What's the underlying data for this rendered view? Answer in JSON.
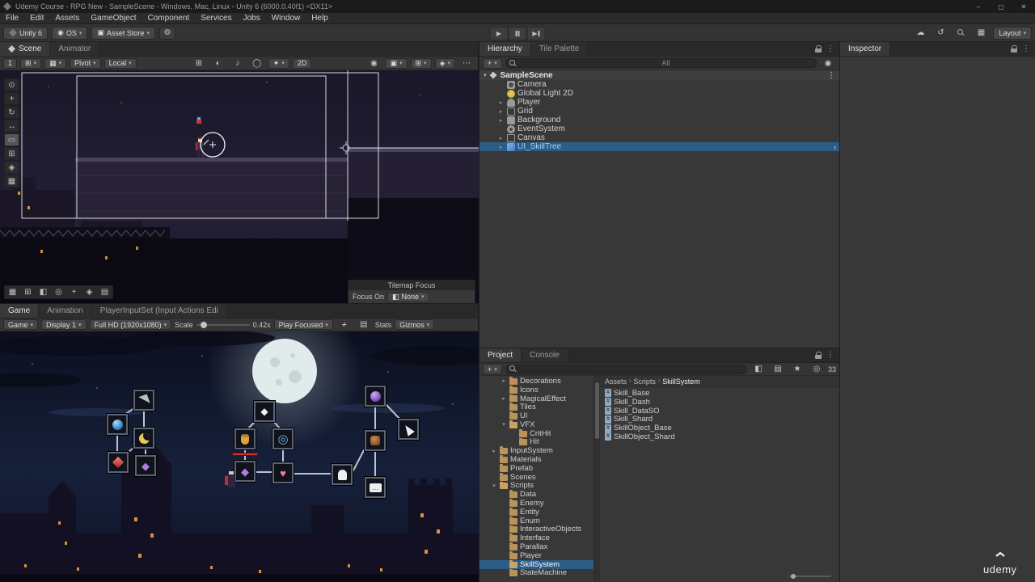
{
  "window": {
    "title": "Udemy Course - RPG New - SampleScene - Windows, Mac, Linux - Unity 6 (6000.0.40f1) <DX11>",
    "controls": {
      "minimize": "–",
      "maximize": "▢",
      "close": "✕"
    }
  },
  "menu": {
    "items": [
      "File",
      "Edit",
      "Assets",
      "GameObject",
      "Component",
      "Services",
      "Jobs",
      "Window",
      "Help"
    ]
  },
  "toolbar": {
    "unity_badge": "Unity 6",
    "os": "OS",
    "asset_store": "Asset Store",
    "layout": "Layout"
  },
  "icons": {
    "caret": "▾",
    "play": "▶",
    "bar": "▏",
    "cloud": "☁",
    "history": "↺",
    "layers": "▦",
    "more": "⋮",
    "ellipsis": "⋯",
    "plus": "+",
    "unity": "◈",
    "user": "◉",
    "bag": "▣",
    "gear": "⚙",
    "arrow_right": "▸",
    "arrow_down": "▾",
    "chevron": "›",
    "star": "★",
    "grid": "⊞",
    "grid_fill": "▦",
    "contrast": "◐",
    "note": "♪",
    "circle": "◯",
    "spark": "✦",
    "camera": "▣",
    "hash": "#",
    "dots3": "…",
    "diamond": "◆",
    "ring": "◎",
    "heart": "♥",
    "eye": "◉",
    "label_tag": "▤",
    "box_half": "◧",
    "target": "◎",
    "tool_view": "⊙",
    "tool_move": "+",
    "tool_rotate": "↻",
    "tool_scale": "↔",
    "tool_rect": "▭",
    "tool_transform": "⊞",
    "tool_custom": "◈",
    "tool_extra": "▦"
  },
  "scene": {
    "tabs": {
      "scene": "Scene",
      "animator": "Animator"
    },
    "toolbar": {
      "tool_number": "1",
      "pivot": "Pivot",
      "orientation": "Local",
      "mode2d": "2D"
    },
    "tilemap_focus": {
      "title": "Tilemap Focus",
      "label": "Focus On",
      "value": "None"
    }
  },
  "game": {
    "tabs": {
      "game": "Game",
      "animation": "Animation",
      "input": "PlayerInputSet (Input Actions Edi"
    },
    "toolbar": {
      "view": "Game",
      "display": "Display 1",
      "resolution": "Full HD (1920x1080)",
      "scale_label": "Scale",
      "scale_value": "0.42x",
      "play_focused": "Play Focused",
      "stats": "Stats",
      "gizmos": "Gizmos"
    }
  },
  "hierarchy": {
    "tabs": {
      "hierarchy": "Hierarchy",
      "tile_palette": "Tile Palette"
    },
    "search": "All",
    "scene_name": "SampleScene",
    "items": [
      {
        "label": "Camera"
      },
      {
        "label": "Global Light 2D"
      },
      {
        "label": "Player"
      },
      {
        "label": "Grid"
      },
      {
        "label": "Background"
      },
      {
        "label": "EventSystem"
      },
      {
        "label": "Canvas"
      },
      {
        "label": "UI_SkillTree"
      }
    ]
  },
  "project": {
    "tabs": {
      "project": "Project",
      "console": "Console"
    },
    "hidden_count": "33",
    "breadcrumb": [
      "Assets",
      "Scripts",
      "SkillSystem"
    ],
    "folders": [
      {
        "label": "Decorations"
      },
      {
        "label": "Icons"
      },
      {
        "label": "MagicalEffect"
      },
      {
        "label": "Tiles"
      },
      {
        "label": "UI"
      },
      {
        "label": "VFX"
      },
      {
        "label": "CritHit"
      },
      {
        "label": "Hit"
      },
      {
        "label": "InputSystem"
      },
      {
        "label": "Materials"
      },
      {
        "label": "Prefab"
      },
      {
        "label": "Scenes"
      },
      {
        "label": "Scripts"
      },
      {
        "label": "Data"
      },
      {
        "label": "Enemy"
      },
      {
        "label": "Entity"
      },
      {
        "label": "Enum"
      },
      {
        "label": "InteractiveObjects"
      },
      {
        "label": "Interface"
      },
      {
        "label": "Parallax"
      },
      {
        "label": "Player"
      },
      {
        "label": "SkillSystem"
      },
      {
        "label": "StateMachine"
      }
    ],
    "files": [
      "Skill_Base",
      "Skill_Dash",
      "Skill_DataSO",
      "Skill_Shard",
      "SkillObject_Base",
      "SkillObject_Shard"
    ]
  },
  "inspector": {
    "tab": "Inspector"
  },
  "watermark": {
    "text": "udemy"
  }
}
